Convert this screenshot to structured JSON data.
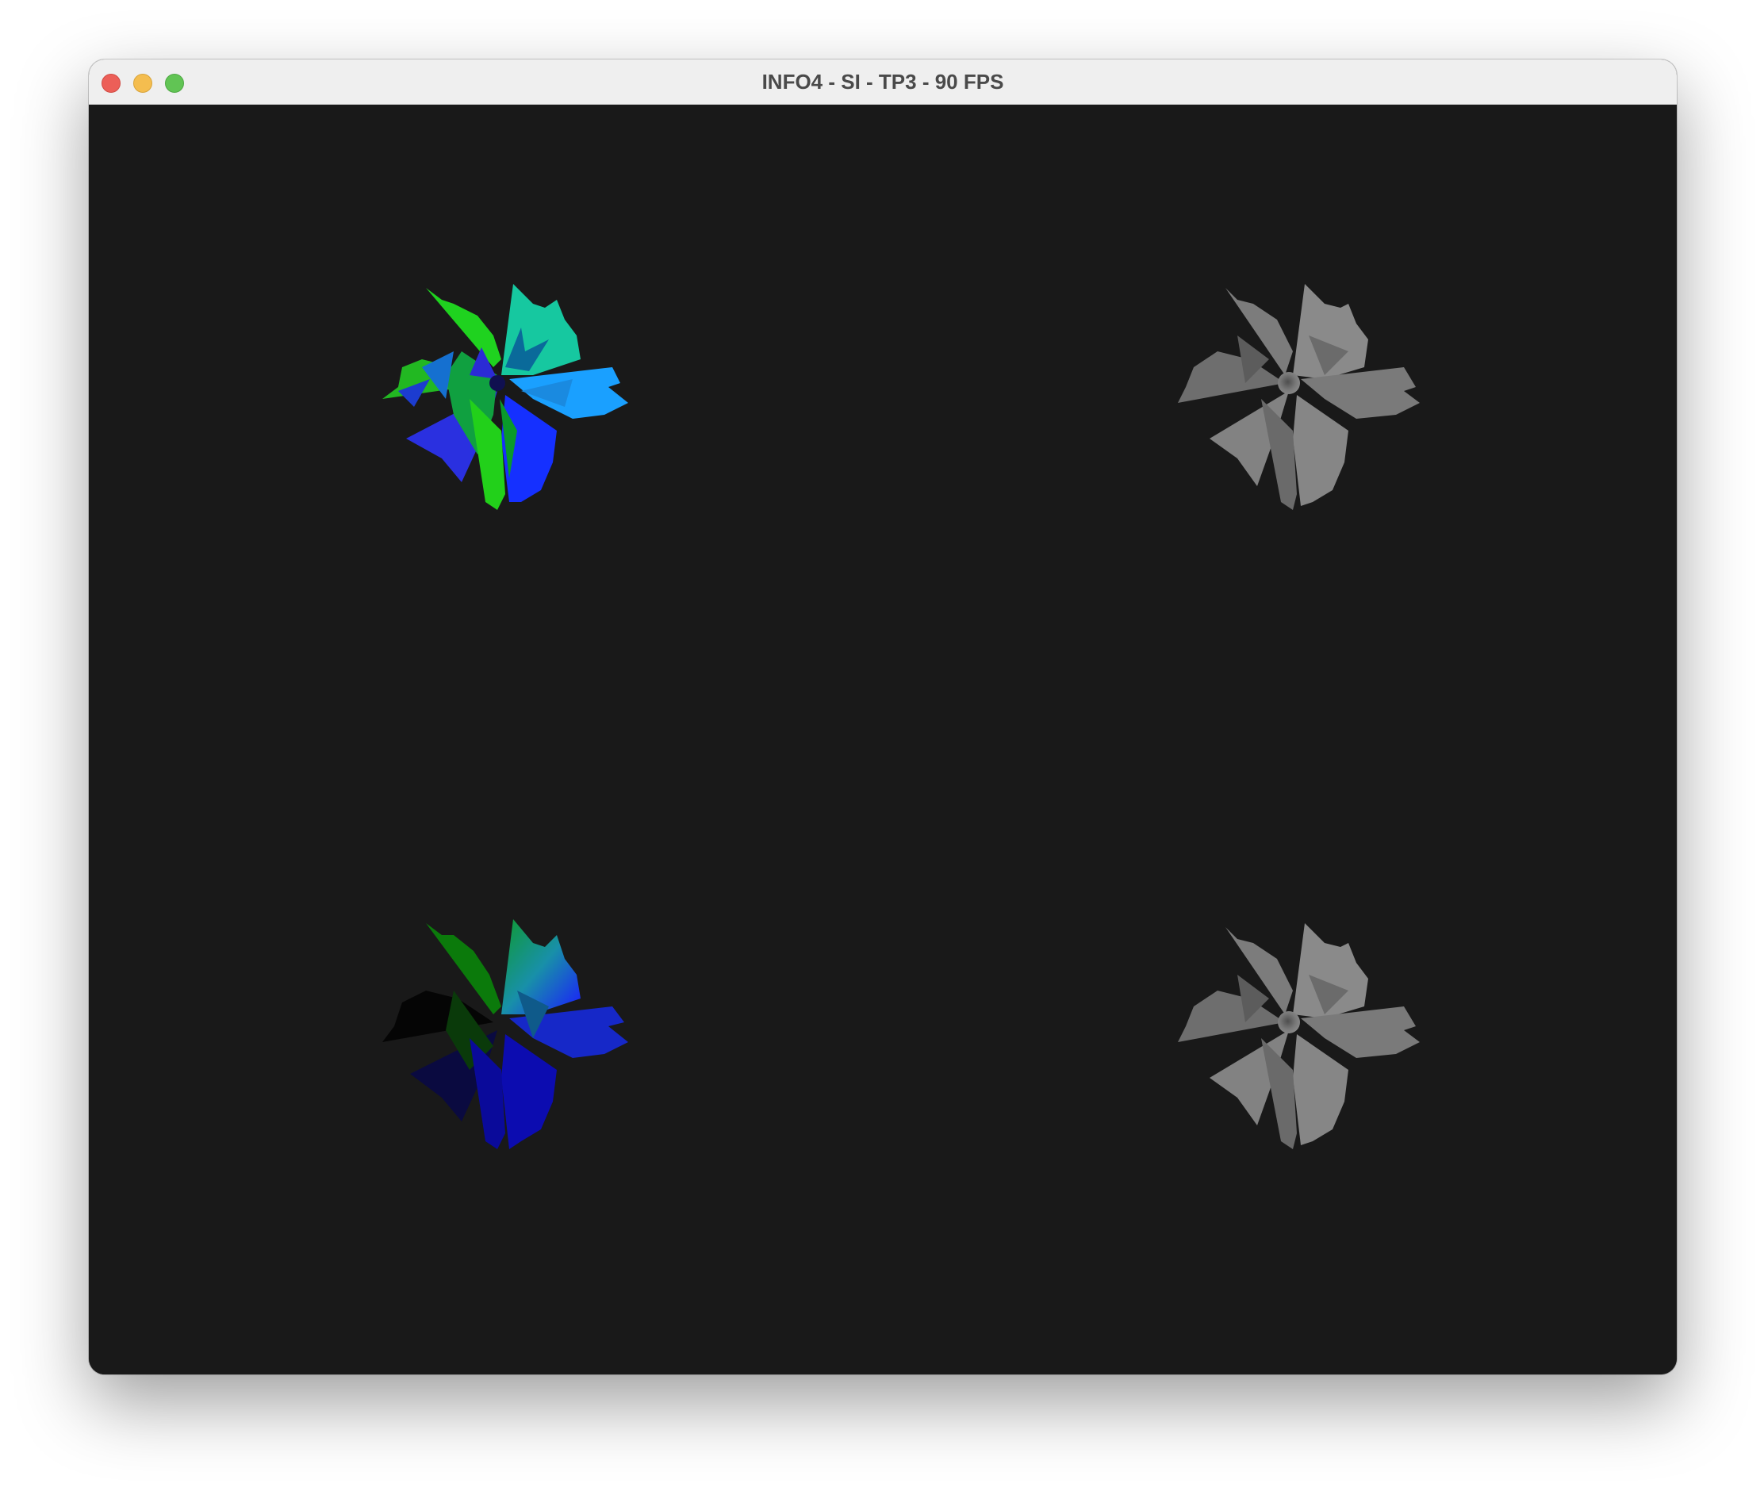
{
  "window": {
    "title": "INFO4 - SI - TP3 - 90 FPS",
    "background_color": "#191919",
    "controls": [
      {
        "name": "close",
        "color": "#ec5f58"
      },
      {
        "name": "minimize",
        "color": "#f4bd4f"
      },
      {
        "name": "zoom",
        "color": "#61c454"
      }
    ]
  },
  "viewports": [
    {
      "name": "normals-shaded",
      "palette": [
        "#1fd21f",
        "#1530ff",
        "#0fa0ff",
        "#2a2ad0"
      ]
    },
    {
      "name": "grey-shaded",
      "palette": [
        "#7a7a7a",
        "#5e5e5e",
        "#8c8c8c"
      ]
    },
    {
      "name": "position-color",
      "palette": [
        "#0a8a0a",
        "#0c0c50",
        "#1a1aff",
        "#1aa0a0"
      ]
    },
    {
      "name": "grey-shaded-2",
      "palette": [
        "#7a7a7a",
        "#5e5e5e",
        "#8c8c8c"
      ]
    }
  ]
}
